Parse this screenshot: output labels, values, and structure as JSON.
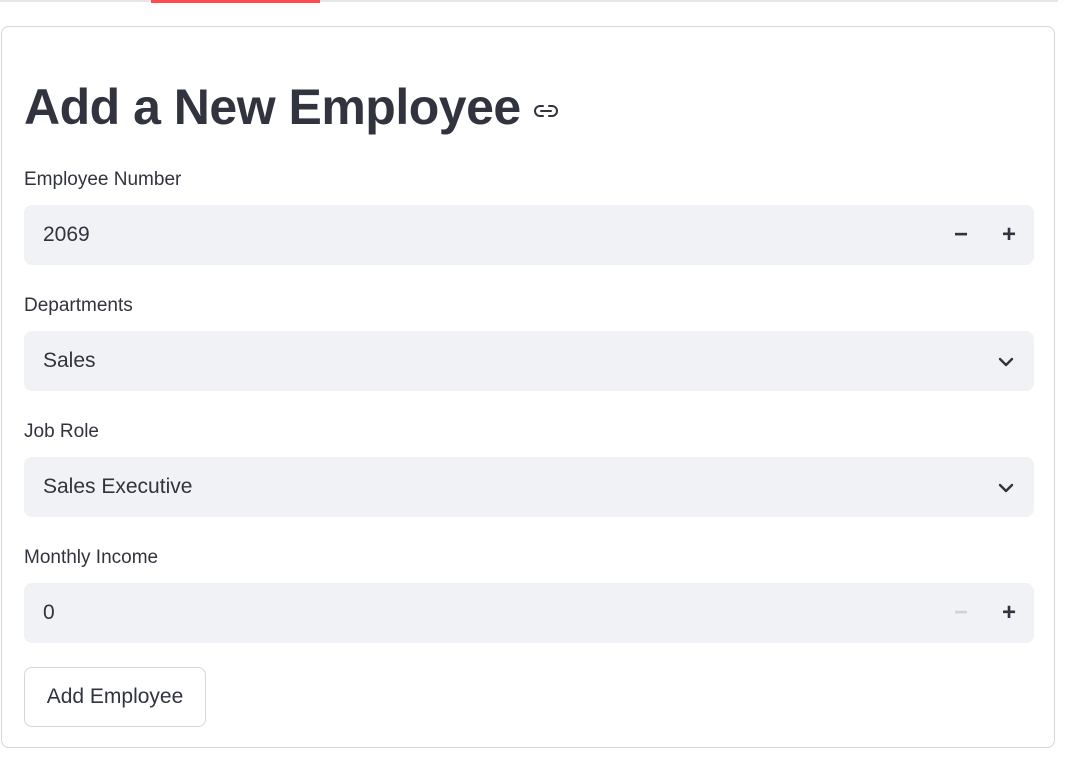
{
  "form": {
    "title": "Add a New Employee",
    "fields": {
      "employee_number": {
        "label": "Employee Number",
        "value": "2069",
        "minus": "−",
        "plus": "+"
      },
      "departments": {
        "label": "Departments",
        "value": "Sales"
      },
      "job_role": {
        "label": "Job Role",
        "value": "Sales Executive"
      },
      "monthly_income": {
        "label": "Monthly Income",
        "value": "0",
        "minus": "−",
        "plus": "+",
        "minus_disabled": true
      }
    },
    "submit_label": "Add Employee"
  },
  "icons": {
    "anchor": "link-icon",
    "dropdown": "chevron-down-icon"
  },
  "colors": {
    "accent": "#ff4b4b",
    "text": "#31333f",
    "input_bg": "#f0f2f6",
    "border": "#d6d6d9"
  }
}
